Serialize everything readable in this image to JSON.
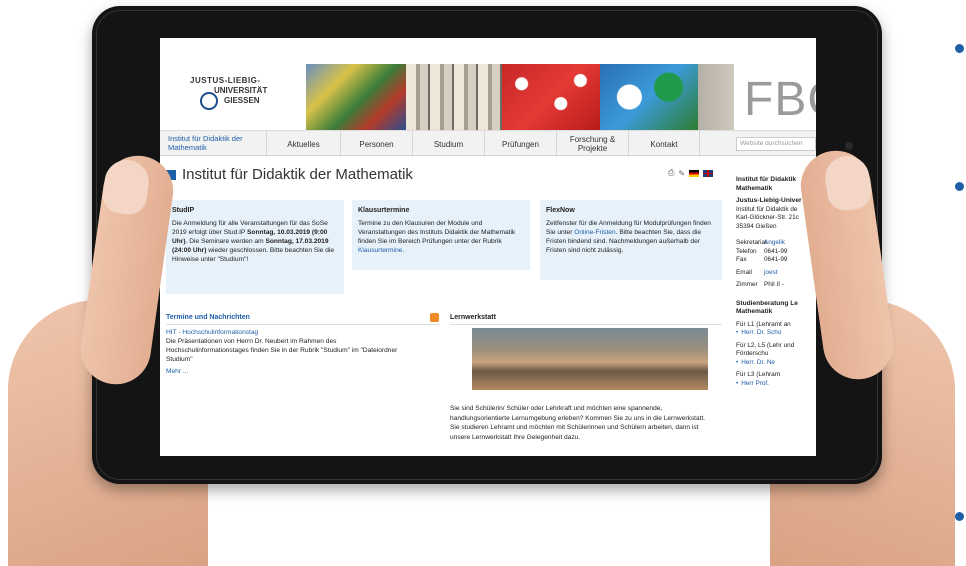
{
  "header": {
    "logo_lines": [
      "JUSTUS-LIEBIG-",
      "UNIVERSITÄT",
      "GIESSEN"
    ],
    "fbc_text": "FBC"
  },
  "nav": {
    "home": "Institut für Didaktik der Mathematik",
    "items": [
      "Aktuelles",
      "Personen",
      "Studium",
      "Prüfungen",
      "Forschung & Projekte",
      "Kontakt"
    ],
    "search_placeholder": "Website durchsuchen"
  },
  "page": {
    "title": "Institut für Didaktik der Mathematik"
  },
  "boxes": {
    "studip": {
      "heading": "StudIP",
      "text_1": "Die Anmeldung für alle Veranstaltungen für das SoSe 2019 erfolgt über Stud.IP ",
      "bold_1": "Sonntag, 10.03.2019 (9:00 Uhr)",
      "text_2": ". Die Seminare werden am ",
      "bold_2": "Sonntag, 17.03.2019 (24:00 Uhr)",
      "text_3": " wieder geschlossen. Bitte beachten Sie die Hinweise unter \"Studium\"!"
    },
    "klausur": {
      "heading": "Klausurtermine",
      "text": "Termine zu den Klausuren der Module und Veranstaltungen des Instituts Didaktik der Mathematik finden Sie im Bereich Prüfungen unter der Rubrik ",
      "link": "Klausurtermine",
      "end": "."
    },
    "flexnow": {
      "heading": "FlexNow",
      "text_1": "Zeitfenster für die Anmeldung für Modulprüfungen finden Sie unter ",
      "link": "Online-Fristen",
      "text_2": ". Bitte beachten Sie, dass die Fristen bindend sind. Nachmeldungen außerhalb der Fristen sind nicht zulässig."
    }
  },
  "news": {
    "heading": "Termine und Nachrichten",
    "item_title": "HIT - Hochschulinformationstag",
    "item_text": "Die Präsentationen von Herrn Dr. Neubert im Rahmen des Hochschulinformationstages finden Sie in der Rubrik \"Studium\" im \"Dateiordner Studium\"",
    "more": "Mehr ..."
  },
  "lernwerkstatt": {
    "heading": "Lernwerkstatt",
    "text": "Sie sind Schülerin/ Schüler oder Lehrkraft und möchten eine spannende, handlungsorientierte Lernumgebung erleben? Kommen Sie zu uns in die Lernwerkstatt. Sie studieren Lehramt und möchten mit Schülerinnen und Schülern arbeiten, dann ist unsere Lernwerkstatt Ihre Gelegenheit dazu."
  },
  "sidebar": {
    "inst_title": "Institut für Didaktik Mathematik",
    "uni": "Justus-Liebig-Univer",
    "addr_1": "Institut für Didaktik de",
    "addr_2": "Karl-Glöckner-Str. 21c",
    "addr_3": "35394 Gießen",
    "sekretariat_label": "Sekretariat",
    "sekretariat_value": "Angelik",
    "telefon_label": "Telefon",
    "telefon_value": "0641-99",
    "fax_label": "Fax",
    "fax_value": "0641-99",
    "email_label": "Email",
    "email_value": "joest",
    "zimmer_label": "Zimmer",
    "zimmer_value": "Phil II -",
    "beratung_title": "Studienberatung Le Mathematik",
    "l1": "Für L1 (Lehramt an",
    "l1_contact": "Herr. Dr. Scho",
    "l2": "Für L2, L5 (Lehr und Förderschu",
    "l2_contact": "Herr. Dr. Ne",
    "l3": "Für L3 (Lehram",
    "l3_contact": "Herr Prof."
  }
}
